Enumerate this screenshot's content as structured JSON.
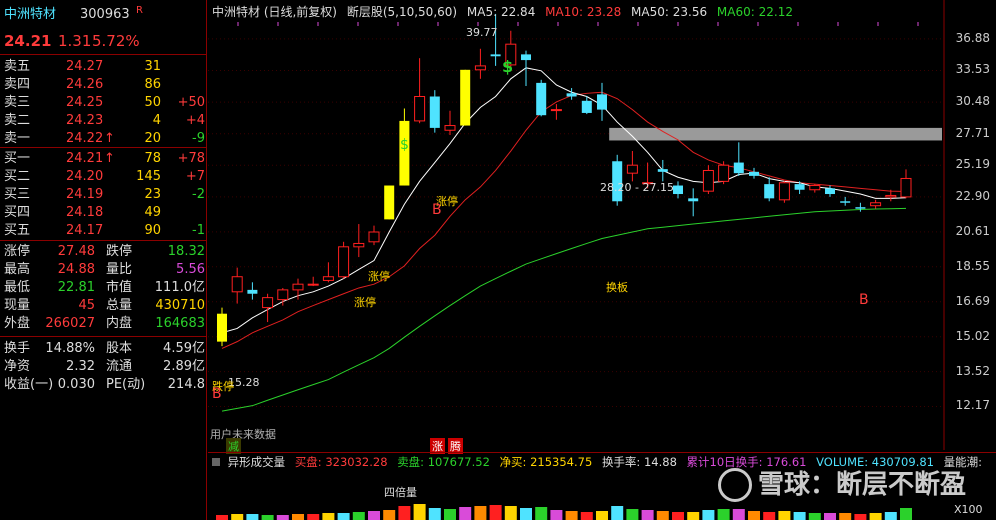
{
  "stock": {
    "name": "中洲特材",
    "code": "300963",
    "flag": "R",
    "price": "24.21",
    "change": "1.31",
    "pct": "5.72%"
  },
  "asks": [
    {
      "label": "卖五",
      "price": "24.27",
      "vol": "31",
      "delta": ""
    },
    {
      "label": "卖四",
      "price": "24.26",
      "vol": "86",
      "delta": ""
    },
    {
      "label": "卖三",
      "price": "24.25",
      "vol": "50",
      "delta": "+50"
    },
    {
      "label": "卖二",
      "price": "24.23",
      "vol": "4",
      "delta": "+4"
    },
    {
      "label": "卖一",
      "price": "24.22",
      "arrow": "↑",
      "vol": "20",
      "delta": "-9"
    }
  ],
  "bids": [
    {
      "label": "买一",
      "price": "24.21",
      "arrow": "↑",
      "vol": "78",
      "delta": "+78"
    },
    {
      "label": "买二",
      "price": "24.20",
      "vol": "145",
      "delta": "+7"
    },
    {
      "label": "买三",
      "price": "24.19",
      "vol": "23",
      "delta": "-2"
    },
    {
      "label": "买四",
      "price": "24.18",
      "vol": "49",
      "delta": ""
    },
    {
      "label": "买五",
      "price": "24.17",
      "vol": "90",
      "delta": "-1"
    }
  ],
  "stats": [
    {
      "l1": "涨停",
      "v1": "27.48",
      "l2": "跌停",
      "v2": "18.32"
    },
    {
      "l1": "最高",
      "v1": "24.88",
      "l2": "量比",
      "v2": "5.56"
    },
    {
      "l1": "最低",
      "v1": "22.81",
      "l2": "市值",
      "v2": "111.0亿"
    },
    {
      "l1": "现量",
      "v1": "45",
      "l2": "总量",
      "v2": "430710"
    },
    {
      "l1": "外盘",
      "v1": "266027",
      "l2": "内盘",
      "v2": "164683"
    }
  ],
  "stats2": [
    {
      "l1": "换手",
      "v1": "14.88%",
      "l2": "股本",
      "v2": "4.59亿"
    },
    {
      "l1": "净资",
      "v1": "2.32",
      "l2": "流通",
      "v2": "2.89亿"
    },
    {
      "l1": "收益(一)",
      "v1": "0.030",
      "l2": "PE(动)",
      "v2": "214.8"
    }
  ],
  "chart_header": {
    "title": "中洲特材 (日线,前复权)",
    "indicator": "断层股(5,10,50,60)",
    "ma5": "MA5: 22.84",
    "ma10": "MA10: 23.28",
    "ma50": "MA50: 23.56",
    "ma60": "MA60: 22.12"
  },
  "colors": {
    "up": "#ff2020",
    "down": "#4fe3ff",
    "ma5": "#ffffff",
    "ma10": "#e02020",
    "ma60": "#2bd12b",
    "highlight": "#ffff00"
  },
  "chart_data": {
    "type": "candlestick",
    "y_ticks": [
      "36.88",
      "33.53",
      "30.48",
      "27.71",
      "25.19",
      "22.90",
      "20.61",
      "18.55",
      "16.69",
      "15.02",
      "13.52",
      "12.17"
    ],
    "ylim": [
      11,
      40
    ],
    "candles": [
      {
        "o": 14.8,
        "h": 16.4,
        "l": 14.6,
        "c": 16.1,
        "hl": true
      },
      {
        "o": 17.2,
        "h": 18.5,
        "l": 16.6,
        "c": 18.0
      },
      {
        "o": 17.3,
        "h": 17.7,
        "l": 16.8,
        "c": 17.1
      },
      {
        "o": 16.4,
        "h": 17.1,
        "l": 15.7,
        "c": 16.9
      },
      {
        "o": 16.8,
        "h": 17.4,
        "l": 16.5,
        "c": 17.3
      },
      {
        "o": 17.3,
        "h": 17.9,
        "l": 16.8,
        "c": 17.6
      },
      {
        "o": 17.6,
        "h": 18.0,
        "l": 17.5,
        "c": 17.6
      },
      {
        "o": 17.8,
        "h": 18.8,
        "l": 17.7,
        "c": 18.0
      },
      {
        "o": 18.0,
        "h": 20.0,
        "l": 17.9,
        "c": 19.7
      },
      {
        "o": 19.7,
        "h": 21.1,
        "l": 19.1,
        "c": 19.9
      },
      {
        "o": 20.0,
        "h": 21.0,
        "l": 19.8,
        "c": 20.6
      },
      {
        "o": 21.4,
        "h": 23.7,
        "l": 21.4,
        "c": 23.7,
        "hl": true
      },
      {
        "o": 23.7,
        "h": 29.9,
        "l": 23.7,
        "c": 28.8,
        "hl": true
      },
      {
        "o": 28.8,
        "h": 34.8,
        "l": 28.6,
        "c": 31.0
      },
      {
        "o": 31.0,
        "h": 31.6,
        "l": 27.8,
        "c": 28.2
      },
      {
        "o": 28.0,
        "h": 29.7,
        "l": 27.6,
        "c": 28.4
      },
      {
        "o": 28.4,
        "h": 33.6,
        "l": 28.4,
        "c": 33.6,
        "hl": true
      },
      {
        "o": 33.6,
        "h": 35.8,
        "l": 32.7,
        "c": 34.0
      },
      {
        "o": 35.2,
        "h": 39.77,
        "l": 34.0,
        "c": 35.0
      },
      {
        "o": 34.1,
        "h": 37.8,
        "l": 33.9,
        "c": 36.3
      },
      {
        "o": 35.2,
        "h": 35.6,
        "l": 32.0,
        "c": 34.6
      },
      {
        "o": 32.3,
        "h": 32.6,
        "l": 29.2,
        "c": 29.3
      },
      {
        "o": 29.8,
        "h": 30.3,
        "l": 28.9,
        "c": 29.8
      },
      {
        "o": 31.3,
        "h": 31.8,
        "l": 30.7,
        "c": 31.0
      },
      {
        "o": 30.6,
        "h": 31.0,
        "l": 29.4,
        "c": 29.5
      },
      {
        "o": 31.2,
        "h": 32.3,
        "l": 28.8,
        "c": 29.8
      },
      {
        "o": 25.5,
        "h": 26.0,
        "l": 22.3,
        "c": 22.6
      },
      {
        "o": 24.6,
        "h": 26.3,
        "l": 24.0,
        "c": 25.2
      },
      {
        "o": 23.9,
        "h": 25.4,
        "l": 23.5,
        "c": 23.9
      },
      {
        "o": 24.9,
        "h": 25.6,
        "l": 24.0,
        "c": 24.7
      },
      {
        "o": 23.7,
        "h": 24.0,
        "l": 22.8,
        "c": 23.1
      },
      {
        "o": 22.8,
        "h": 23.5,
        "l": 21.6,
        "c": 22.6
      },
      {
        "o": 23.3,
        "h": 25.2,
        "l": 23.1,
        "c": 24.8
      },
      {
        "o": 24.0,
        "h": 25.5,
        "l": 23.8,
        "c": 25.2
      },
      {
        "o": 25.4,
        "h": 27.0,
        "l": 24.4,
        "c": 24.6
      },
      {
        "o": 24.7,
        "h": 25.0,
        "l": 24.2,
        "c": 24.4
      },
      {
        "o": 23.8,
        "h": 24.3,
        "l": 22.6,
        "c": 22.8
      },
      {
        "o": 22.7,
        "h": 24.0,
        "l": 22.5,
        "c": 23.9
      },
      {
        "o": 23.8,
        "h": 24.0,
        "l": 23.1,
        "c": 23.4
      },
      {
        "o": 23.4,
        "h": 23.8,
        "l": 23.2,
        "c": 23.7
      },
      {
        "o": 23.5,
        "h": 23.7,
        "l": 22.9,
        "c": 23.1
      },
      {
        "o": 22.6,
        "h": 22.9,
        "l": 22.3,
        "c": 22.5
      },
      {
        "o": 22.2,
        "h": 22.5,
        "l": 21.9,
        "c": 22.1
      },
      {
        "o": 22.3,
        "h": 22.7,
        "l": 22.1,
        "c": 22.5
      },
      {
        "o": 22.9,
        "h": 23.4,
        "l": 22.6,
        "c": 23.0
      },
      {
        "o": 22.9,
        "h": 24.88,
        "l": 22.81,
        "c": 24.21
      }
    ],
    "ma5": [
      15.2,
      15.4,
      15.9,
      16.3,
      16.7,
      17.0,
      17.2,
      17.5,
      17.9,
      18.4,
      18.9,
      20.6,
      22.4,
      24.0,
      25.4,
      26.9,
      28.6,
      30.0,
      31.0,
      32.7,
      33.8,
      33.5,
      32.1,
      31.4,
      31.0,
      30.2,
      28.7,
      27.5,
      26.2,
      24.8,
      24.3,
      24.0,
      23.9,
      24.0,
      24.5,
      24.6,
      24.2,
      24.0,
      23.9,
      23.6,
      23.5,
      23.3,
      23.1,
      22.8,
      22.8,
      22.84
    ],
    "ma10": [
      14.5,
      14.8,
      15.2,
      15.5,
      15.8,
      16.2,
      16.5,
      16.8,
      17.1,
      17.4,
      17.6,
      18.0,
      18.6,
      19.6,
      20.4,
      21.6,
      22.7,
      23.6,
      24.8,
      26.3,
      28.0,
      29.6,
      30.5,
      31.1,
      31.3,
      31.4,
      30.8,
      29.8,
      28.7,
      27.9,
      27.2,
      26.2,
      25.6,
      25.2,
      25.0,
      24.7,
      24.4,
      24.1,
      23.9,
      23.8,
      23.7,
      23.6,
      23.5,
      23.4,
      23.3,
      23.28
    ],
    "ma60": [
      12.0,
      12.1,
      12.2,
      12.4,
      12.6,
      12.8,
      13.0,
      13.2,
      13.5,
      13.8,
      14.1,
      14.5,
      15.0,
      15.5,
      16.0,
      16.5,
      17.0,
      17.5,
      17.9,
      18.3,
      18.7,
      19.0,
      19.3,
      19.6,
      19.9,
      20.2,
      20.4,
      20.6,
      20.8,
      20.9,
      21.0,
      21.1,
      21.2,
      21.3,
      21.4,
      21.5,
      21.6,
      21.7,
      21.8,
      21.9,
      21.95,
      22.0,
      22.05,
      22.08,
      22.1,
      22.12
    ],
    "gap_zone": {
      "low": 27.15,
      "high": 28.2,
      "label": "28.20 - 27.15"
    },
    "high_label": "39.77",
    "low_label": "15.28"
  },
  "annotations": {
    "zt": "涨停",
    "ztb": "跌停",
    "b": "B",
    "dollar": "$",
    "hb": "换板",
    "warn": "用户未来数据",
    "jian": "减",
    "zhang": "涨",
    "teng": "腾"
  },
  "volume_header": {
    "title": "异形成交量",
    "buy": "买盘: 323032.28",
    "sell": "卖盘: 107677.52",
    "net": "净买: 215354.75",
    "turnover": "换手率: 14.88",
    "cum10": "累计10日换手: 176.61",
    "volume": "VOLUME: 430709.81",
    "energy": "量能潮:",
    "vol_label": "四倍量",
    "x100": "X100"
  },
  "watermark": "雪球：断层不断盈"
}
